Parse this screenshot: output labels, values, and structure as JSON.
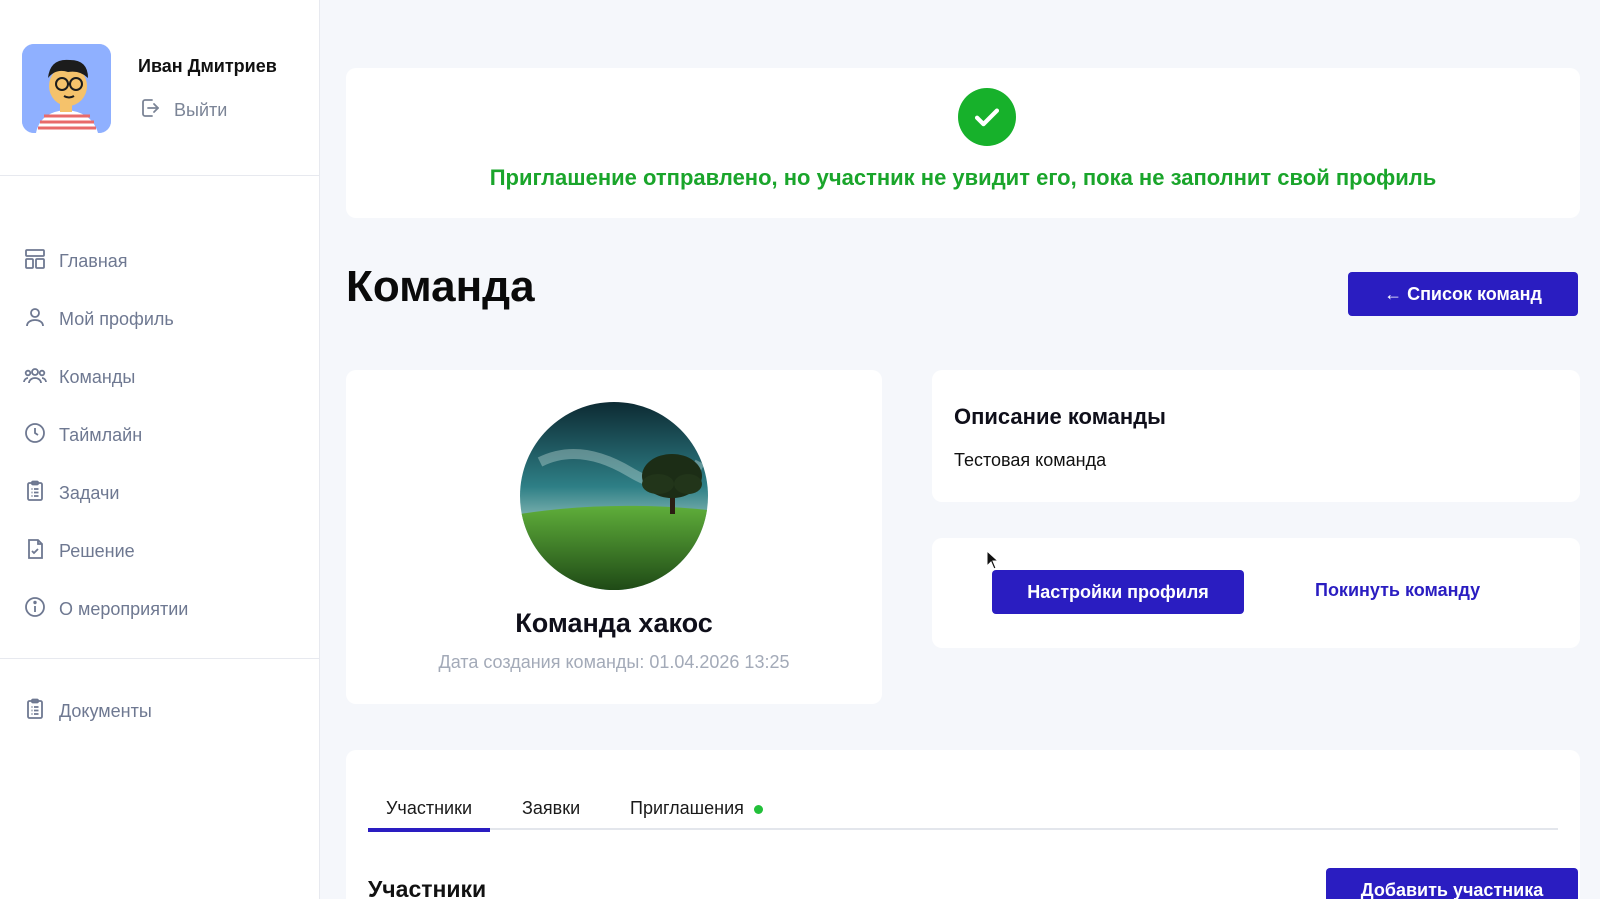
{
  "sidebar": {
    "user": {
      "name": "Иван Дмитриев",
      "logout_label": "Выйти"
    },
    "nav": [
      {
        "label": "Главная",
        "icon": "home-layout-icon"
      },
      {
        "label": "Мой профиль",
        "icon": "user-icon"
      },
      {
        "label": "Команды",
        "icon": "users-icon"
      },
      {
        "label": "Таймлайн",
        "icon": "clock-icon"
      },
      {
        "label": "Задачи",
        "icon": "clipboard-icon"
      },
      {
        "label": "Решение",
        "icon": "file-check-icon"
      },
      {
        "label": "О мероприятии",
        "icon": "info-icon"
      }
    ],
    "nav_secondary": [
      {
        "label": "Документы",
        "icon": "clipboard-icon"
      }
    ]
  },
  "notice": {
    "icon": "check-circle-icon",
    "text": "Приглашение отправлено, но участник не увидит его, пока не заполнит свой профиль",
    "color": "#1aa52b"
  },
  "page": {
    "title": "Команда",
    "back_button": "← Список команд"
  },
  "team": {
    "name": "Команда хакос",
    "created": "Дата создания команды: 01.04.2026 13:25"
  },
  "description": {
    "title": "Описание команды",
    "text": "Тестовая команда"
  },
  "actions": {
    "settings_button": "Настройки профиля",
    "leave_link": "Покинуть команду"
  },
  "tabs": [
    {
      "label": "Участники",
      "active": true
    },
    {
      "label": "Заявки",
      "active": false
    },
    {
      "label": "Приглашения",
      "active": false,
      "badge_dot": true
    }
  ],
  "members": {
    "title": "Участники",
    "add_button": "Добавить участника"
  },
  "colors": {
    "accent": "#2a1dc1",
    "success": "#1aa52b",
    "muted": "#6e7891"
  }
}
